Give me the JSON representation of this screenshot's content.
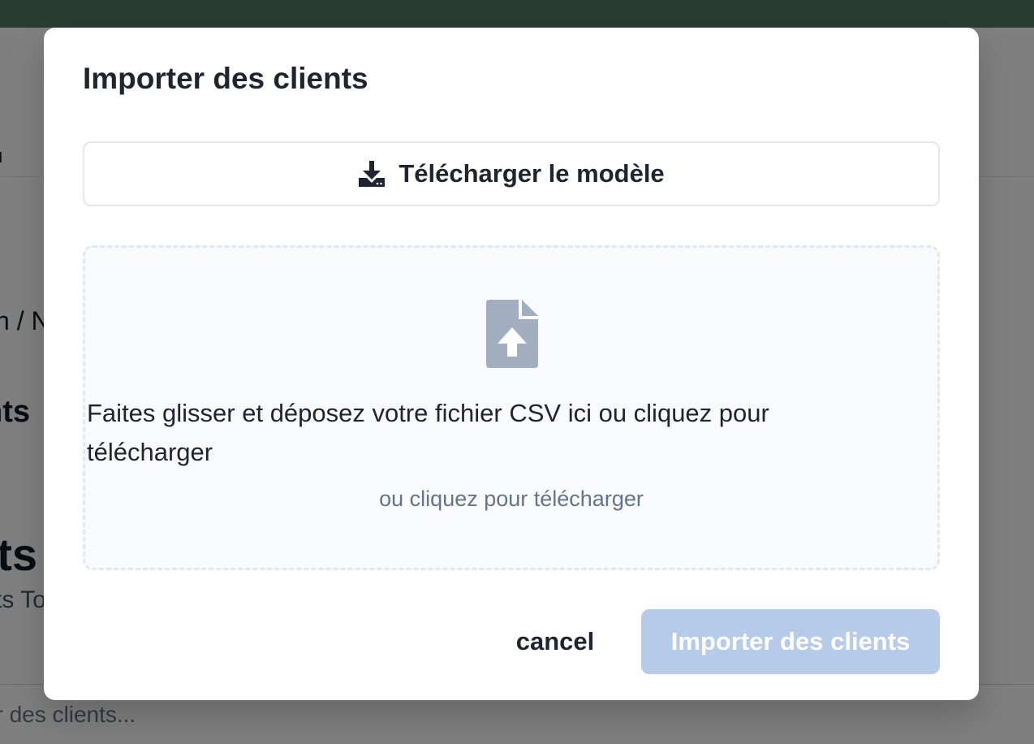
{
  "background": {
    "nav_partial_text": "u",
    "breadcrumb_partial": "n / N",
    "heading_partial": "nts",
    "page_title_partial": "nts",
    "subtitle_partial": "ts To",
    "search": {
      "placeholder": "rcher des clients..."
    }
  },
  "modal": {
    "title": "Importer des clients",
    "download_template_label": "Télécharger le modèle",
    "dropzone": {
      "main_text": "Faites glisser et déposez votre fichier CSV ici ou cliquez pour télécharger",
      "sub_text": "ou cliquez pour télécharger"
    },
    "cancel_label": "cancel",
    "import_label": "Importer des clients"
  },
  "icons": {
    "download": "download-icon",
    "file_upload": "file-upload-icon"
  },
  "colors": {
    "topbar": "#4f7a62",
    "primary_disabled": "#b6cbea",
    "text_dark": "#1f2430",
    "muted": "#64748b",
    "icon_gray": "#a0aec0"
  }
}
